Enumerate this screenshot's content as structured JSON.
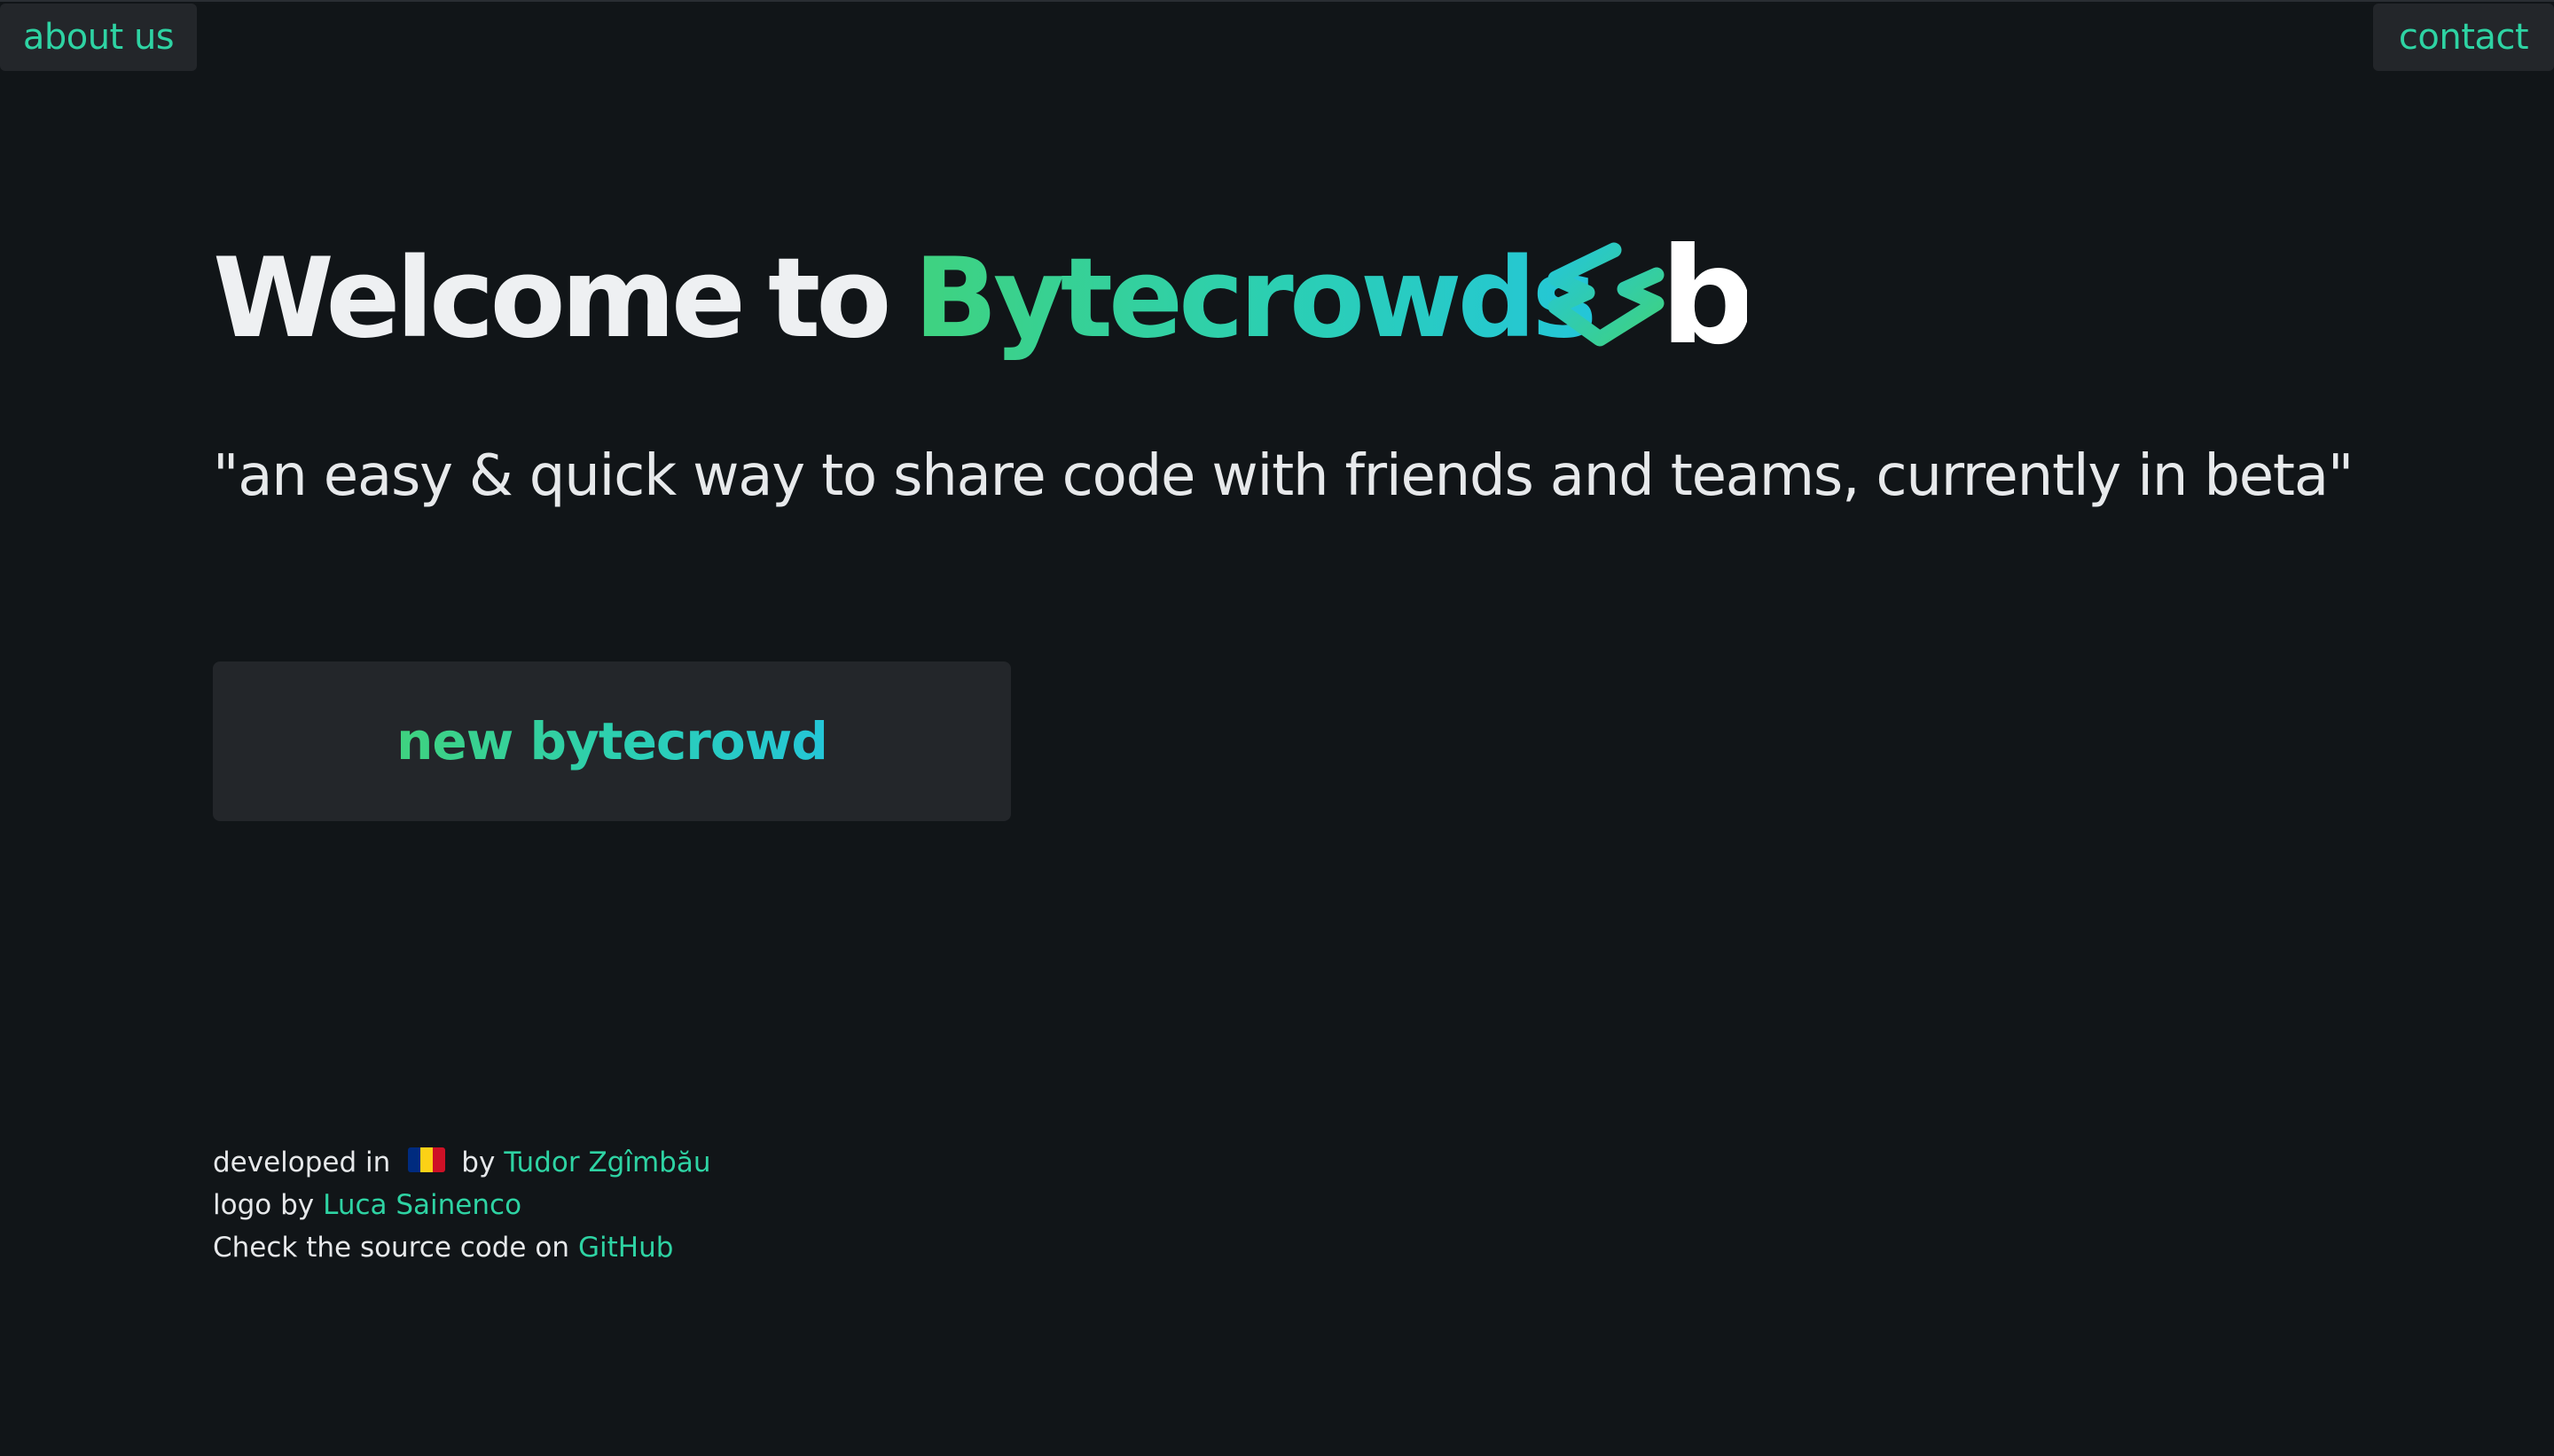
{
  "nav": {
    "about_label": "about us",
    "contact_label": "contact"
  },
  "hero": {
    "title_prefix_word1": "Welcome",
    "title_prefix_word2": "to",
    "title_brand": "Bytecrowds",
    "logo_letter": "b",
    "tagline": "\"an easy & quick way to share code with friends and teams, currently in beta\""
  },
  "cta": {
    "label": "new bytecrowd"
  },
  "footer": {
    "developed_in": "developed in",
    "by": "by",
    "developer_name": "Tudor Zgîmbău",
    "logo_by": "logo by",
    "logo_author": "Luca Sainenco",
    "source_text": "Check the source code on",
    "source_link": "GitHub",
    "flag_icon": "romania-flag-icon"
  },
  "colors": {
    "background": "#111518",
    "surface": "#23262a",
    "accent_green": "#3fd27f",
    "accent_cyan": "#24c6d8",
    "link": "#2ed3a3",
    "flag_blue": "#002b7f",
    "flag_yellow": "#fcd116",
    "flag_red": "#ce1126"
  }
}
